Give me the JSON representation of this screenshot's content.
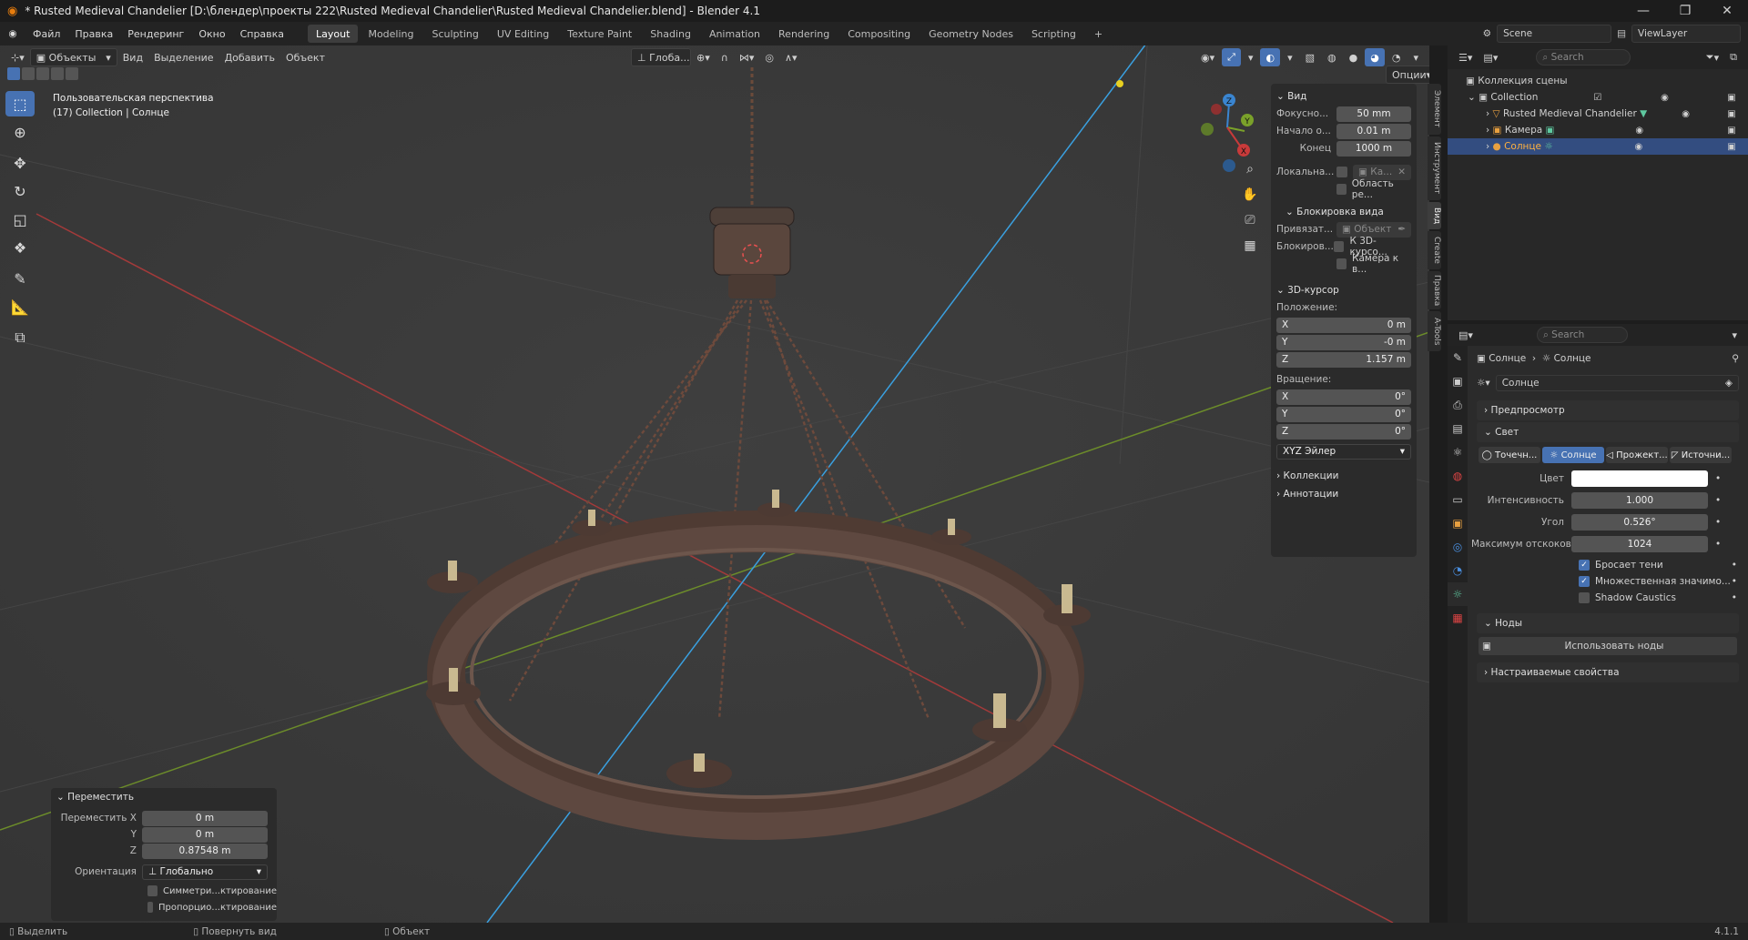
{
  "window": {
    "title": "* Rusted Medieval Chandelier [D:\\блендер\\проекты 222\\Rusted Medieval Chandelier\\Rusted Medieval Chandelier.blend] - Blender 4.1"
  },
  "menu": {
    "items": [
      "Файл",
      "Правка",
      "Рендеринг",
      "Окно",
      "Справка"
    ]
  },
  "workspaces": {
    "tabs": [
      "Layout",
      "Modeling",
      "Sculpting",
      "UV Editing",
      "Texture Paint",
      "Shading",
      "Animation",
      "Rendering",
      "Compositing",
      "Geometry Nodes",
      "Scripting"
    ],
    "active": "Layout",
    "add": "+"
  },
  "scene": {
    "name": "Scene",
    "view_layer": "ViewLayer"
  },
  "viewport_header": {
    "mode": "Объекты",
    "menus": [
      "Вид",
      "Выделение",
      "Добавить",
      "Объект"
    ],
    "transform_orientation": "Глоба...",
    "options": "Опции"
  },
  "viewport": {
    "overlay_line1": "Пользовательская перспектива",
    "overlay_line2": "(17) Collection | Солнце",
    "gizmo_axes": {
      "x": "X",
      "y": "Y",
      "z": "Z"
    }
  },
  "npanel": {
    "view_section": "Вид",
    "focal_label": "Фокусно...",
    "focal_value": "50 mm",
    "clip_start_label": "Начало о...",
    "clip_start_value": "0.01 m",
    "clip_end_label": "Конец",
    "clip_end_value": "1000 m",
    "local_camera_label": "Локальна...",
    "local_camera_value": "Ка...",
    "render_region": "Область ре...",
    "view_lock_section": "Блокировка вида",
    "lock_to_label": "Привязат...",
    "lock_to_value": "Объект",
    "lock_label": "Блокиров...",
    "lock_cursor": "К 3D-курсо...",
    "lock_camera": "Камера к в...",
    "cursor_section": "3D-курсор",
    "location_label": "Положение:",
    "cursor_x": "0 m",
    "cursor_y": "-0 m",
    "cursor_z": "1.157 m",
    "rotation_label": "Вращение:",
    "rot_x": "0°",
    "rot_y": "0°",
    "rot_z": "0°",
    "rotation_mode": "XYZ Эйлер",
    "collections_section": "Коллекции",
    "annotations_section": "Аннотации",
    "axis_x": "X",
    "axis_y": "Y",
    "axis_z": "Z"
  },
  "ntabs": [
    "Элемент",
    "Инструмент",
    "Вид",
    "Create",
    "Правка",
    "A-Tools"
  ],
  "ntabs_active": "Вид",
  "redo_panel": {
    "title": "Переместить",
    "move_x_label": "Переместить X",
    "move_x": "0 m",
    "y_label": "Y",
    "move_y": "0 m",
    "z_label": "Z",
    "move_z": "0.87548 m",
    "orientation_label": "Ориентация",
    "orientation_value": "Глобально",
    "symmetry": "Симметри...ктирование",
    "proportional": "Пропорцио...ктирование"
  },
  "outliner": {
    "search_placeholder": "Search",
    "scene_collection": "Коллекция сцены",
    "collection": "Collection",
    "items": [
      "Rusted Medieval Chandelier",
      "Камера",
      "Солнце"
    ],
    "selected": "Солнце"
  },
  "properties": {
    "search_placeholder": "Search",
    "breadcrumb_object": "Солнце",
    "breadcrumb_data": "Солнце",
    "datablock_name": "Солнце",
    "preview_section": "Предпросмотр",
    "light_section": "Свет",
    "light_types": [
      "Точечн...",
      "Солнце",
      "Прожект...",
      "Источни..."
    ],
    "light_type_active": "Солнце",
    "color_label": "Цвет",
    "color_value": "#ffffff",
    "strength_label": "Интенсивность",
    "strength_value": "1.000",
    "angle_label": "Угол",
    "angle_value": "0.526°",
    "max_bounces_label": "Максимум отскоков",
    "max_bounces_value": "1024",
    "cast_shadow": "Бросает тени",
    "multiple_importance": "Множественная значимо...",
    "shadow_caustics": "Shadow Caustics",
    "nodes_section": "Ноды",
    "use_nodes_button": "Использовать ноды",
    "custom_props_section": "Настраиваемые свойства"
  },
  "statusbar": {
    "select": "Выделить",
    "rotate_view": "Повернуть вид",
    "object": "Объект",
    "version": "4.1.1"
  },
  "colors": {
    "accent": "#4772b3",
    "selection": "#334d80",
    "axis_x": "#c83a3a",
    "axis_y": "#7aa12a",
    "axis_z": "#3aa0e0"
  }
}
